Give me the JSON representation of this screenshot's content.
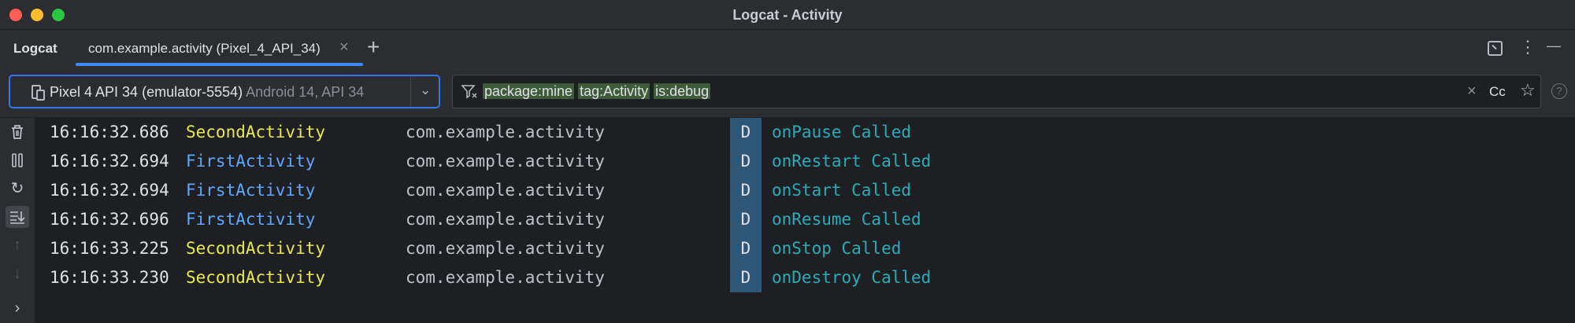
{
  "window": {
    "title": "Logcat - Activity"
  },
  "tabbar": {
    "tool_name": "Logcat",
    "tabs": [
      {
        "label": "com.example.activity (Pixel_4_API_34)",
        "close": "×"
      }
    ],
    "add": "+",
    "menu": "⋮",
    "minimize": "—"
  },
  "toolbar": {
    "device": {
      "name": "Pixel 4 API 34 (emulator-5554)",
      "details": "Android 14, API 34",
      "chevron": "⌄"
    },
    "filter": {
      "chips": [
        "package:mine",
        "tag:Activity",
        "is:debug"
      ],
      "clear": "×",
      "case_sensitive": "Cc",
      "favorite": "☆"
    },
    "help": "?"
  },
  "sidebar": {
    "buttons": [
      {
        "icon": "trash-icon",
        "glyph": "🗑"
      },
      {
        "icon": "pause-icon",
        "glyph": "⏸"
      },
      {
        "icon": "restart-icon",
        "glyph": "↻"
      },
      {
        "icon": "scroll-to-end-icon",
        "glyph": "⇊"
      },
      {
        "icon": "arrow-up-icon",
        "glyph": "↑"
      },
      {
        "icon": "arrow-down-icon",
        "glyph": "↓"
      },
      {
        "icon": "expand-icon",
        "glyph": "›"
      }
    ]
  },
  "colors": {
    "tag_yellow": "#e8ea4b",
    "tag_blue": "#5ea7ff",
    "message": "#2aacb8",
    "level_bg": "#2d5677",
    "accent": "#3574f0"
  },
  "log": {
    "rows": [
      {
        "time": "16:16:32.686",
        "tag": "SecondActivity",
        "tag_color": "yellow",
        "package": "com.example.activity",
        "level": "D",
        "message": "onPause Called"
      },
      {
        "time": "16:16:32.694",
        "tag": "FirstActivity",
        "tag_color": "blue",
        "package": "com.example.activity",
        "level": "D",
        "message": "onRestart Called"
      },
      {
        "time": "16:16:32.694",
        "tag": "FirstActivity",
        "tag_color": "blue",
        "package": "com.example.activity",
        "level": "D",
        "message": "onStart Called"
      },
      {
        "time": "16:16:32.696",
        "tag": "FirstActivity",
        "tag_color": "blue",
        "package": "com.example.activity",
        "level": "D",
        "message": "onResume Called"
      },
      {
        "time": "16:16:33.225",
        "tag": "SecondActivity",
        "tag_color": "yellow",
        "package": "com.example.activity",
        "level": "D",
        "message": "onStop Called"
      },
      {
        "time": "16:16:33.230",
        "tag": "SecondActivity",
        "tag_color": "yellow",
        "package": "com.example.activity",
        "level": "D",
        "message": "onDestroy Called"
      }
    ]
  }
}
